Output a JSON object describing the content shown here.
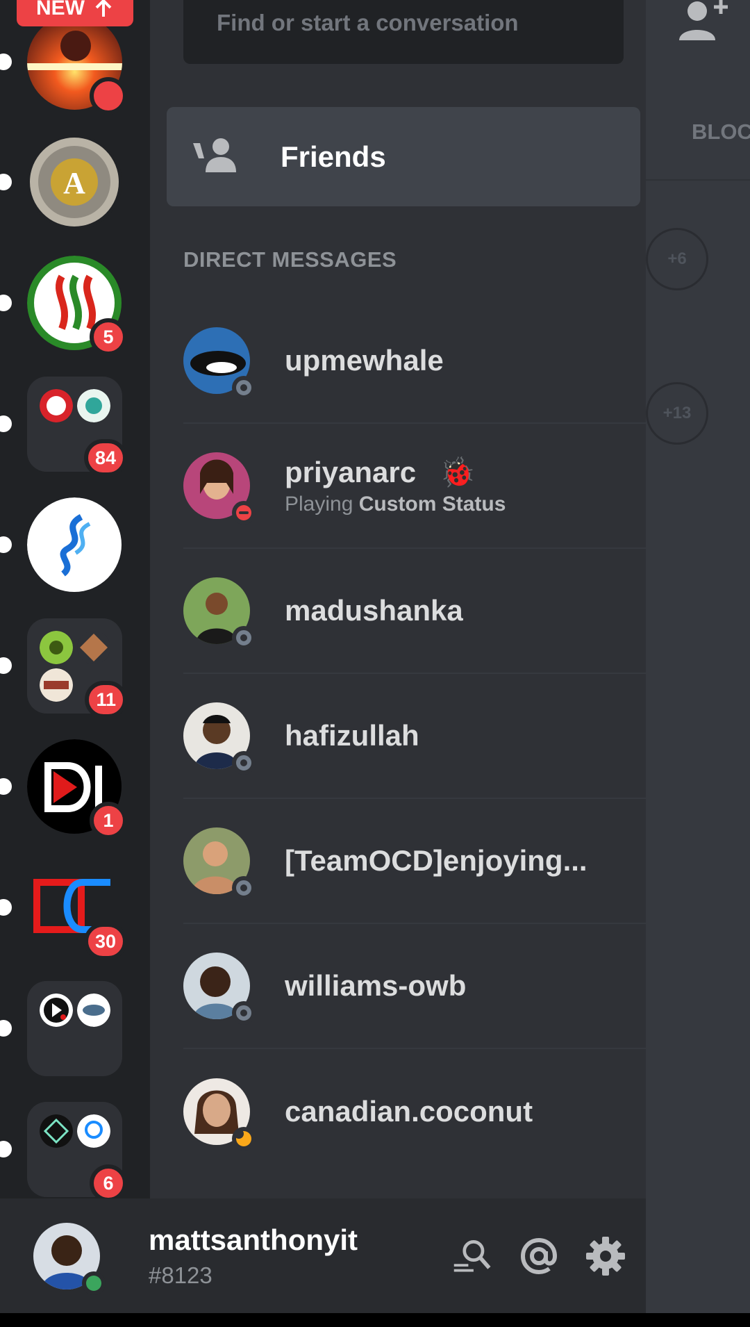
{
  "new_pill": {
    "label": "NEW"
  },
  "search": {
    "placeholder": "Find or start a conversation"
  },
  "friends": {
    "label": "Friends"
  },
  "dm_section": {
    "heading": "DIRECT MESSAGES"
  },
  "direct_messages": [
    {
      "name": "upmewhale",
      "status": "offline"
    },
    {
      "name": "priyanarc",
      "emoji": "🐞",
      "activity_prefix": "Playing",
      "activity": "Custom Status",
      "status": "dnd"
    },
    {
      "name": "madushanka",
      "status": "offline"
    },
    {
      "name": "hafizullah",
      "status": "offline"
    },
    {
      "name": "[TeamOCD]enjoying...",
      "status": "offline"
    },
    {
      "name": "williams-owb",
      "status": "offline"
    },
    {
      "name": "canadian.coconut",
      "status": "idle"
    }
  ],
  "guilds": [
    {
      "type": "server",
      "badge": ""
    },
    {
      "type": "server",
      "badge": null
    },
    {
      "type": "server",
      "badge": "5"
    },
    {
      "type": "folder",
      "badge": "84"
    },
    {
      "type": "server",
      "badge": null
    },
    {
      "type": "folder",
      "badge": "11"
    },
    {
      "type": "server",
      "badge": "1"
    },
    {
      "type": "server",
      "badge": "30"
    },
    {
      "type": "folder",
      "badge": null
    },
    {
      "type": "folder",
      "badge": "6"
    }
  ],
  "user_panel": {
    "username": "mattsanthonyit",
    "tag": "#8123",
    "status": "online"
  },
  "right_panel": {
    "tab": "BLOCKED",
    "counts": [
      "+6",
      "+13"
    ]
  },
  "colors": {
    "accent": "#ed4245",
    "online": "#3ba55d",
    "idle": "#faa81a",
    "offline": "#747f8d"
  }
}
